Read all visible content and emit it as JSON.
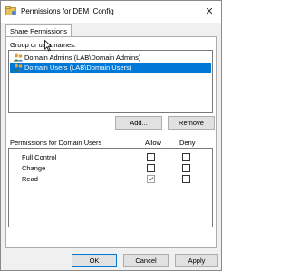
{
  "window": {
    "title": "Permissions for DEM_Config",
    "close_glyph": "✕"
  },
  "tab": {
    "label": "Share Permissions"
  },
  "groups": {
    "label": "Group or user names:",
    "items": [
      {
        "label": "Domain Admins (LAB\\Domain Admins)",
        "selected": false
      },
      {
        "label": "Domain Users (LAB\\Domain Users)",
        "selected": true
      }
    ]
  },
  "buttons": {
    "add": "Add...",
    "remove": "Remove",
    "ok": "OK",
    "cancel": "Cancel",
    "apply": "Apply"
  },
  "permissions": {
    "label": "Permissions for Domain Users",
    "allow_header": "Allow",
    "deny_header": "Deny",
    "rows": [
      {
        "name": "Full Control",
        "allow": false,
        "deny": false
      },
      {
        "name": "Change",
        "allow": false,
        "deny": false
      },
      {
        "name": "Read",
        "allow": true,
        "deny": false
      }
    ]
  },
  "colors": {
    "selection": "#0078d7",
    "background": "#f0f0f0"
  }
}
